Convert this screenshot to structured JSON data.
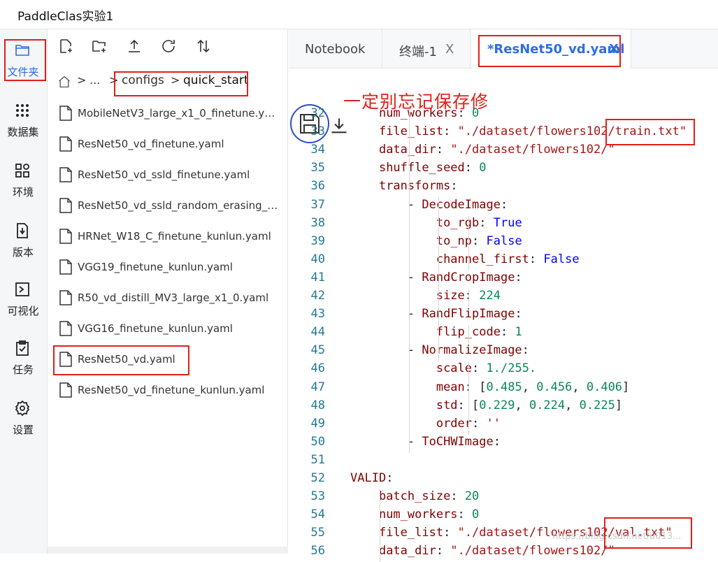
{
  "app": {
    "title": "PaddleClas实验1"
  },
  "rail": {
    "items": [
      {
        "label": "文件夹",
        "icon": "folder-icon",
        "active": true
      },
      {
        "label": "数据集",
        "icon": "dataset-icon"
      },
      {
        "label": "环境",
        "icon": "environment-icon"
      },
      {
        "label": "版本",
        "icon": "version-icon"
      },
      {
        "label": "可视化",
        "icon": "visualization-icon"
      },
      {
        "label": "任务",
        "icon": "task-icon"
      },
      {
        "label": "设置",
        "icon": "settings-icon"
      }
    ]
  },
  "toolbar": {
    "icons": [
      "new-file-icon",
      "new-folder-icon",
      "upload-icon",
      "refresh-icon",
      "sort-icon"
    ]
  },
  "breadcrumb": {
    "home_icon": "home-icon",
    "sep": ">",
    "ellipsis": "...",
    "parts": [
      "configs",
      "quick_start"
    ]
  },
  "files": [
    "MobileNetV3_large_x1_0_finetune.yaml",
    "ResNet50_vd_finetune.yaml",
    "ResNet50_vd_ssld_finetune.yaml",
    "ResNet50_vd_ssld_random_erasing_fi...",
    "HRNet_W18_C_finetune_kunlun.yaml",
    "VGG19_finetune_kunlun.yaml",
    "R50_vd_distill_MV3_large_x1_0.yaml",
    "VGG16_finetune_kunlun.yaml",
    "ResNet50_vd.yaml",
    "ResNet50_vd_finetune_kunlun.yaml"
  ],
  "tabs": [
    {
      "label": "Notebook"
    },
    {
      "label": "终端-1",
      "close": "X"
    },
    {
      "label": "*ResNet50_vd.yaml",
      "close": "X",
      "active": true
    }
  ],
  "editor_toolbar": {
    "save_icon": "save-icon",
    "download_icon": "download-icon"
  },
  "annotation": "一定别忘记保存修",
  "code": [
    {
      "n": "32",
      "t": "    num_workers: 0"
    },
    {
      "n": "33",
      "t": "    file_list: \"./dataset/flowers102/train.txt\""
    },
    {
      "n": "34",
      "t": "    data_dir: \"./dataset/flowers102/\""
    },
    {
      "n": "35",
      "t": "    shuffle_seed: 0"
    },
    {
      "n": "36",
      "t": "    transforms:"
    },
    {
      "n": "37",
      "t": "        - DecodeImage:"
    },
    {
      "n": "38",
      "t": "            to_rgb: True"
    },
    {
      "n": "39",
      "t": "            to_np: False"
    },
    {
      "n": "40",
      "t": "            channel_first: False"
    },
    {
      "n": "41",
      "t": "        - RandCropImage:"
    },
    {
      "n": "42",
      "t": "            size: 224"
    },
    {
      "n": "43",
      "t": "        - RandFlipImage:"
    },
    {
      "n": "44",
      "t": "            flip_code: 1"
    },
    {
      "n": "45",
      "t": "        - NormalizeImage:"
    },
    {
      "n": "46",
      "t": "            scale: 1./255."
    },
    {
      "n": "47",
      "t": "            mean: [0.485, 0.456, 0.406]"
    },
    {
      "n": "48",
      "t": "            std: [0.229, 0.224, 0.225]"
    },
    {
      "n": "49",
      "t": "            order: ''"
    },
    {
      "n": "50",
      "t": "        - ToCHWImage:"
    },
    {
      "n": "51",
      "t": ""
    },
    {
      "n": "52",
      "t": "VALID:"
    },
    {
      "n": "53",
      "t": "    batch_size: 20"
    },
    {
      "n": "54",
      "t": "    num_workers: 0"
    },
    {
      "n": "55",
      "t": "    file_list: \"./dataset/flowers102/val.txt\""
    },
    {
      "n": "56",
      "t": "    data_dir: \"./dataset/flowers102/\""
    }
  ],
  "watermark": "https://blog.csdn.net/u013..."
}
